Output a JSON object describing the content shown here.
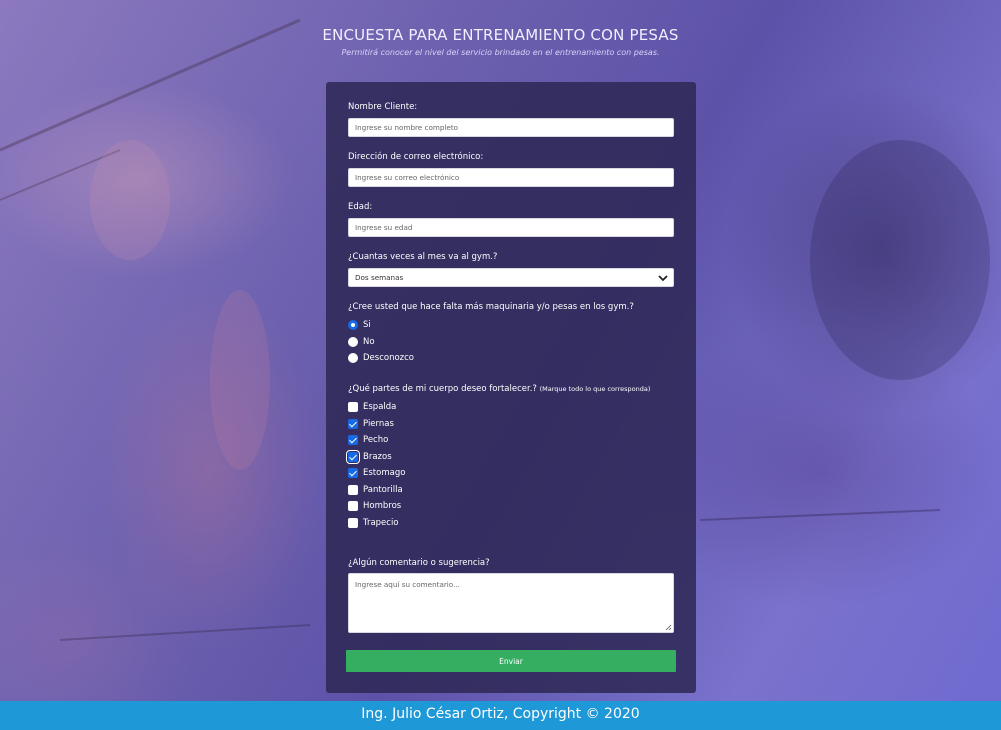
{
  "header": {
    "title": "ENCUESTA PARA ENTRENAMIENTO CON PESAS",
    "subtitle": "Permitirá conocer el nivel del servicio brindado en el entrenamiento con pesas."
  },
  "form": {
    "name": {
      "label": "Nombre Cliente:",
      "placeholder": "Ingrese su nombre completo",
      "value": ""
    },
    "email": {
      "label": "Dirección de correo electrónico:",
      "placeholder": "Ingrese su correo electrónico",
      "value": ""
    },
    "age": {
      "label": "Edad:",
      "placeholder": "Ingrese su edad",
      "value": ""
    },
    "frequency": {
      "label": "¿Cuantas veces al mes va al gym.?",
      "selected": "Dos semanas",
      "icon": "chevron-down-icon"
    },
    "machinery": {
      "label": "¿Cree usted que hace falta más maquinaria y/o pesas en los gym.?",
      "options": [
        {
          "label": "Si",
          "selected": true
        },
        {
          "label": "No",
          "selected": false
        },
        {
          "label": "Desconozco",
          "selected": false
        }
      ]
    },
    "body_parts": {
      "label": "¿Qué partes de mi cuerpo deseo fortalecer.?",
      "note": "(Marque todo lo que corresponda)",
      "options": [
        {
          "label": "Espalda",
          "checked": false
        },
        {
          "label": "Piernas",
          "checked": true
        },
        {
          "label": "Pecho",
          "checked": true
        },
        {
          "label": "Brazos",
          "checked": true
        },
        {
          "label": "Estomago",
          "checked": true
        },
        {
          "label": "Pantorilla",
          "checked": false
        },
        {
          "label": "Hombros",
          "checked": false
        },
        {
          "label": "Trapecio",
          "checked": false
        }
      ]
    },
    "comments": {
      "label": "¿Algún comentario o sugerencia?",
      "placeholder": "Ingrese aquí su comentario..."
    },
    "submit_label": "Enviar"
  },
  "footer": {
    "text": "Ing. Julio César Ortiz, Copyright © 2020"
  },
  "colors": {
    "accent": "#1769e6",
    "submit": "#35ae62",
    "footer": "#1e98d6",
    "panel": "#2d2855"
  }
}
